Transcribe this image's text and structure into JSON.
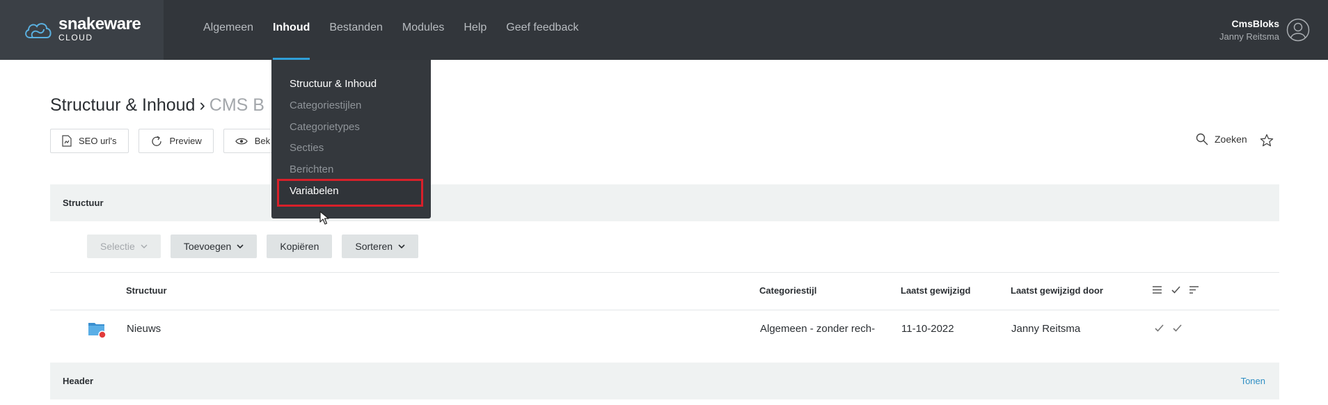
{
  "brand": {
    "name": "snakeware",
    "sub": "CLOUD"
  },
  "nav": [
    {
      "label": "Algemeen",
      "active": false
    },
    {
      "label": "Inhoud",
      "active": true
    },
    {
      "label": "Bestanden",
      "active": false
    },
    {
      "label": "Modules",
      "active": false
    },
    {
      "label": "Help",
      "active": false
    },
    {
      "label": "Geef feedback",
      "active": false
    }
  ],
  "user": {
    "site": "CmsBloks",
    "name": "Janny Reitsma"
  },
  "page": {
    "title": "Structuur & Inhoud",
    "separator": "›",
    "subtitle": "CMS B"
  },
  "toolbar": {
    "seo": "SEO url's",
    "preview": "Preview",
    "view": "Bek",
    "search": "Zoeken"
  },
  "dropdown": {
    "items": [
      "Structuur & Inhoud",
      "Categoriestijlen",
      "Categorietypes",
      "Secties",
      "Berichten",
      "Variabelen"
    ],
    "highlighted": "Variabelen"
  },
  "structure_section": {
    "label": "Structuur"
  },
  "actions": {
    "select": "Selectie",
    "add": "Toevoegen",
    "copy": "Kopiëren",
    "sort": "Sorteren"
  },
  "table": {
    "headers": {
      "structure": "Structuur",
      "style": "Categoriestijl",
      "modified": "Laatst gewijzigd",
      "modified_by": "Laatst gewijzigd door"
    },
    "rows": [
      {
        "name": "Nieuws",
        "style": "Algemeen - zonder rech-",
        "modified": "11-10-2022",
        "modified_by": "Janny Reitsma"
      }
    ]
  },
  "header_section": {
    "label": "Header",
    "action": "Tonen"
  },
  "colors": {
    "topbar": "#32363b",
    "accent": "#2f9fd8",
    "highlight": "#d8202a",
    "link": "#2f8fc4"
  }
}
